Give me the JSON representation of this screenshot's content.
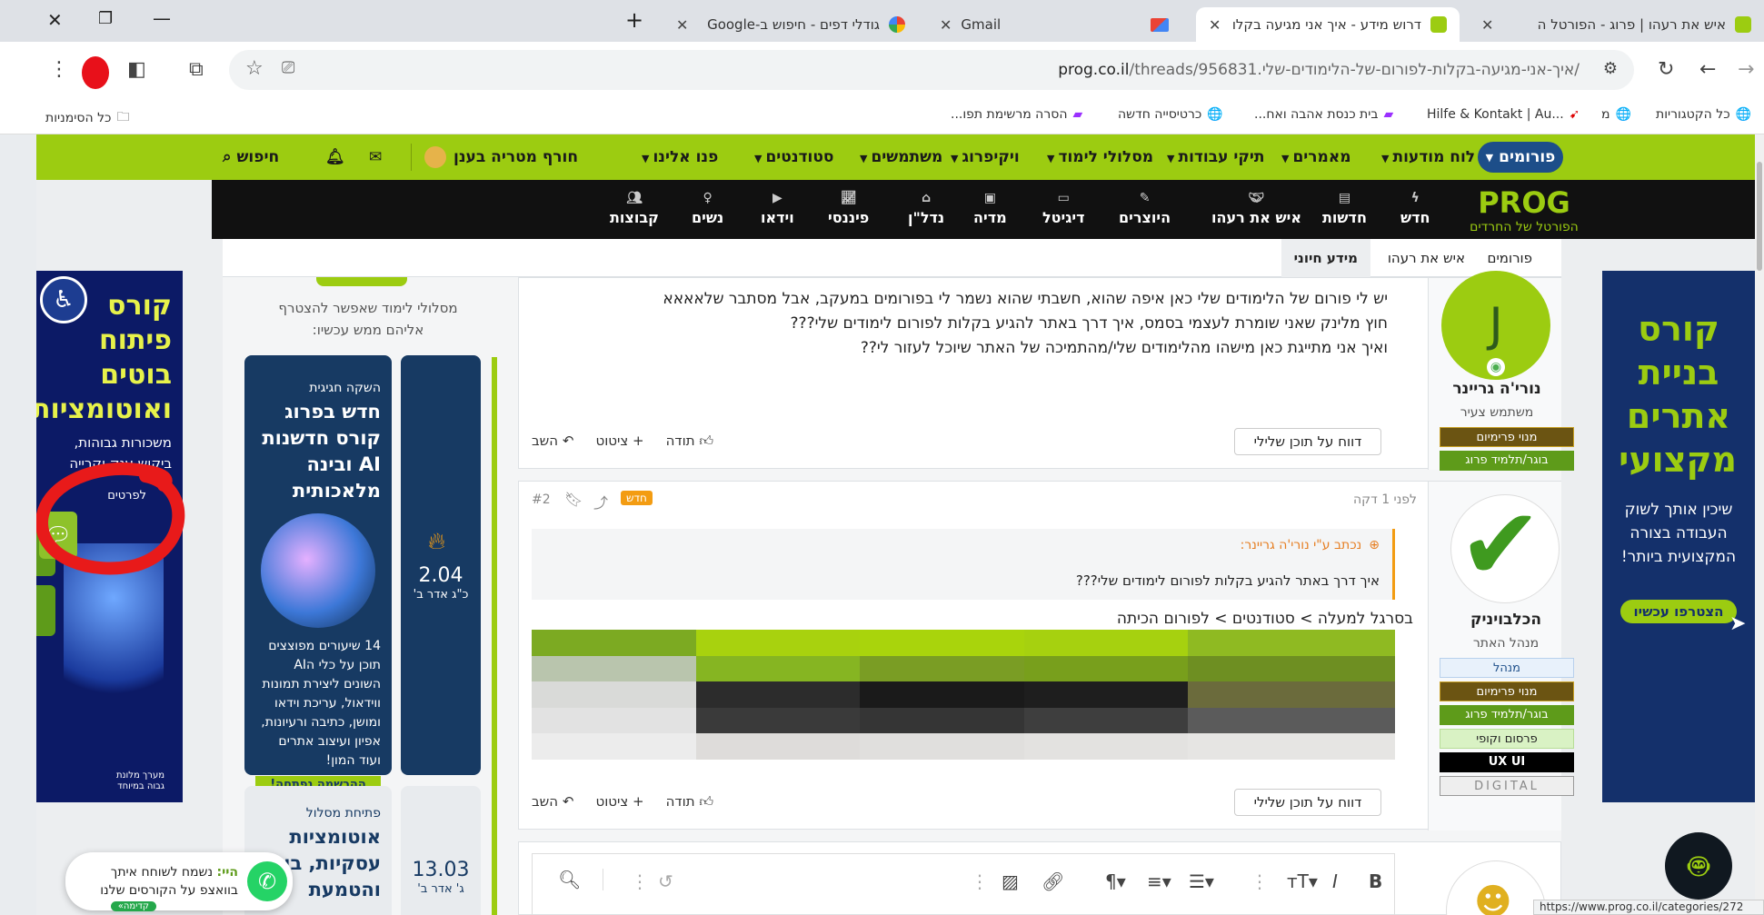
{
  "browser": {
    "tabs": [
      {
        "title": "איש את רעהו | פרוג - הפורטל ה",
        "active": false
      },
      {
        "title": "דרוש מידע - איך אני מגיעה בקלו",
        "active": true
      },
      {
        "title": "Gmail",
        "active": false
      },
      {
        "title": "גודלי דפים - חיפוש ב-Google",
        "active": false
      }
    ],
    "new_tab": "+",
    "url_domain": "prog.co.il",
    "url_path": "/threads/956831.איך-אני-מגיעה-בקלות-לפורום-של-הלימודים-שלי/",
    "status_url": "https://www.prog.co.il/categories/272"
  },
  "bookmarks": {
    "items": [
      "כל הקטגוריות",
      "מ",
      "Hilfe & Kontakt | Au...",
      "בית כנסת אהבה ואח...",
      "כרטיסייה חדשה",
      "הסרה מרשימת תפו..."
    ],
    "all_bookmarks": "כל הסימניות"
  },
  "site": {
    "topnav": {
      "forums": "פורומים",
      "items": [
        "לוח מודעות",
        "מאמרים",
        "תיקי עבודות",
        "מסלולי לימוד",
        "ויקיפרוג",
        "משתמשים",
        "סטודנטים",
        "פנו אלינו"
      ],
      "user": "חורף מטריה בענן",
      "search": "חיפוש"
    },
    "logo_text": "PROG",
    "logo_sub": "הפורטל של החרדים",
    "categories": [
      "חדש",
      "חדשות",
      "איש את רעהו",
      "היוצרים",
      "דיגיטל",
      "מדיה",
      "נדל\"ן",
      "פיננסי",
      "וידאו",
      "נשים",
      "קבוצות"
    ],
    "breadcrumb": [
      "פורומים",
      "איש את רעהו",
      "מידע חיוני"
    ]
  },
  "posts": [
    {
      "author": "נורי'ה גריינר",
      "avatar_letter": "J",
      "role": "משתמש צעיר",
      "badges": [
        "מנוי פרימיום",
        "בוגר/תלמיד פרוג"
      ],
      "lines": [
        "יש לי פורום של הלימודים שלי כאן איפה שהוא, חשבתי שהוא נשמר לי בפורומים במעקב, אבל מסתבר שלאאאא",
        "חוץ מלינק שאני שומרת לעצמי בסמס, איך דרך באתר להגיע בקלות לפורום לימודים שלי???",
        "ואיך אני מתייגת כאן מישהו מהלימודים שלי/מהתמיכה של האתר שיוכל לעזור לי??"
      ],
      "actions": {
        "like": "תודה",
        "quote": "ציטוט",
        "reply": "השב",
        "report": "דווח על תוכן שלילי"
      }
    },
    {
      "author": "הכלבויניק",
      "role": "מנהל האתר",
      "time": "לפני 1 דקה",
      "num": "#2",
      "new_tag": "חדש",
      "badges": [
        "מנהל",
        "מנוי פרימיום",
        "בוגר/תלמיד פרוג",
        "פרסום וקופי",
        "UX UI",
        "DIGITAL"
      ],
      "quote_head": "נכתב ע\"י נורי'ה גריינר:",
      "quote_text": "איך דרך באתר להגיע בקלות לפורום לימודים שלי???",
      "answer": "בסרגל למעלה > סטודנטים > לפורום הכיתה",
      "actions": {
        "like": "תודה",
        "quote": "ציטוט",
        "reply": "השב",
        "report": "דווח על תוכן שלילי"
      }
    }
  ],
  "sidebar": {
    "intro": "מסלולי לימוד שאפשר להצטרף אליהם ממש עכשיו:",
    "course1": {
      "tag": "השקה חגיגית",
      "title": "חדש בפרוג קורס חדשנות AI ובינה מלאכותית",
      "desc": "14 שיעורים מפוצצים תוכן על כלי הAI השונים ליצירת תמונות ווידאול, עריכת וידאו ומושן, כתיבה ורעיונות, אפיון ועיצוב אתרים ועוד המון!",
      "cta": "ההרשמה נפתחה!",
      "price": "2.04",
      "date": "כ\"ג אדר ב'"
    },
    "course2": {
      "tag": "פתיחת מסלול",
      "title": "אוטומציות עסקיות, בוט והטמעת",
      "price": "13.03",
      "date": "ג' אדר ב'"
    }
  },
  "ads": {
    "left": {
      "title": "קורס פיתוח בוטים ואוטומציות",
      "sub": "משכורות גבוהות, ביקוש ענק וקרייה",
      "cta": "לפרטים",
      "foot": "מערך מלונת גבוה במיוחד"
    },
    "right": {
      "title": "קורס בניית אתרים מקצועי",
      "sub": "שיכין אותך לשוק העבודה בצורה המקצועית ביותר!",
      "cta": "הצטרפו עכשיו"
    }
  },
  "whatsapp": {
    "hi": "היי:",
    "text": "נשמח לשוחח איתך בוואצפ על הקורסים שלנו",
    "tag": "קדימה»"
  },
  "colors": {
    "brand_green": "#9ccc11",
    "brand_blue": "#1d4e89",
    "dark": "#111111"
  }
}
